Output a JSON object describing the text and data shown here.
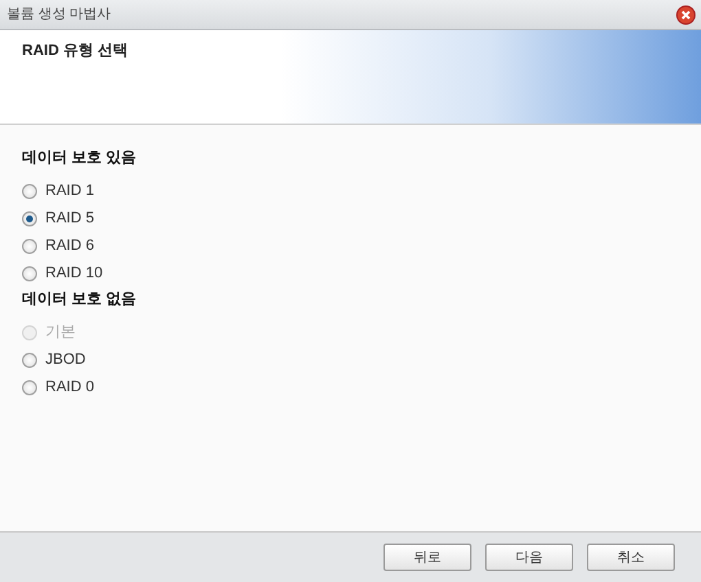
{
  "window": {
    "title": "볼륨 생성 마법사"
  },
  "header": {
    "title": "RAID 유형 선택"
  },
  "groups": [
    {
      "heading": "데이터 보호 있음",
      "options": [
        {
          "label": "RAID 1",
          "selected": false,
          "disabled": false
        },
        {
          "label": "RAID 5",
          "selected": true,
          "disabled": false
        },
        {
          "label": "RAID 6",
          "selected": false,
          "disabled": false
        },
        {
          "label": "RAID 10",
          "selected": false,
          "disabled": false
        }
      ]
    },
    {
      "heading": "데이터 보호 없음",
      "options": [
        {
          "label": "기본",
          "selected": false,
          "disabled": true
        },
        {
          "label": "JBOD",
          "selected": false,
          "disabled": false
        },
        {
          "label": "RAID 0",
          "selected": false,
          "disabled": false
        }
      ]
    }
  ],
  "buttons": [
    {
      "label": "뒤로"
    },
    {
      "label": "다음"
    },
    {
      "label": "취소"
    }
  ]
}
